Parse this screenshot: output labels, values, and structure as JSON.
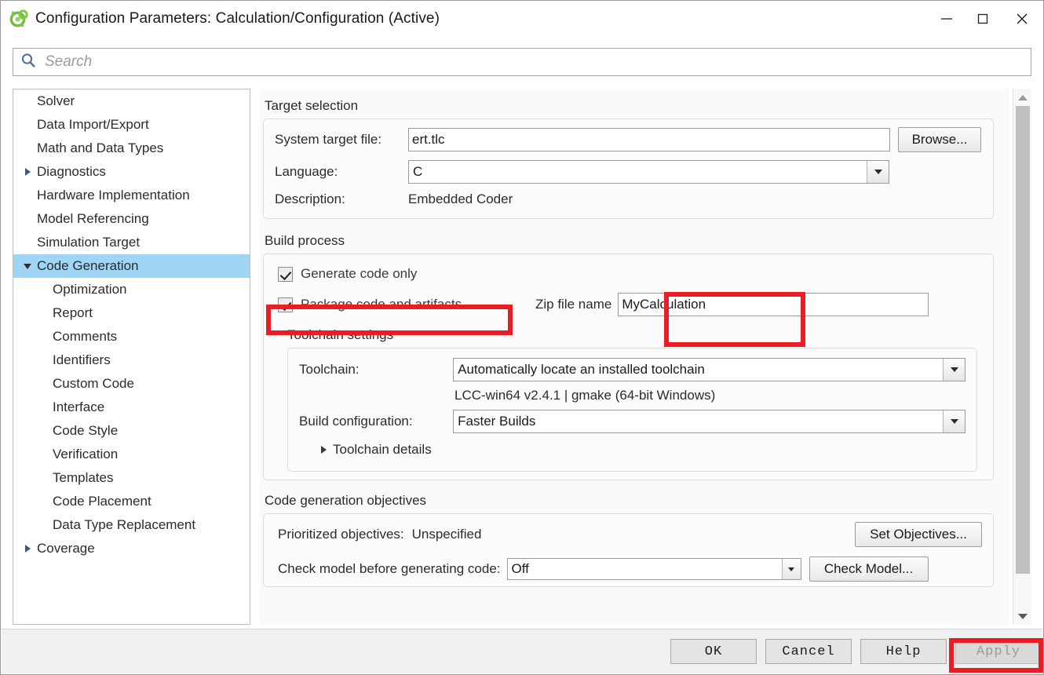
{
  "window": {
    "title": "Configuration Parameters: Calculation/Configuration (Active)",
    "icon": "simulink-icon",
    "minimize_label": "─",
    "maximize_label": "□",
    "close_label": "✕"
  },
  "search": {
    "placeholder": "Search",
    "value": "",
    "icon": "search-icon"
  },
  "sidebar": {
    "items": [
      {
        "label": "Solver",
        "level": 0,
        "twisty": "none",
        "selected": false
      },
      {
        "label": "Data Import/Export",
        "level": 0,
        "twisty": "none",
        "selected": false
      },
      {
        "label": "Math and Data Types",
        "level": 0,
        "twisty": "none",
        "selected": false
      },
      {
        "label": "Diagnostics",
        "level": 0,
        "twisty": "collapsed",
        "selected": false
      },
      {
        "label": "Hardware Implementation",
        "level": 0,
        "twisty": "none",
        "selected": false
      },
      {
        "label": "Model Referencing",
        "level": 0,
        "twisty": "none",
        "selected": false
      },
      {
        "label": "Simulation Target",
        "level": 0,
        "twisty": "none",
        "selected": false
      },
      {
        "label": "Code Generation",
        "level": 0,
        "twisty": "expanded",
        "selected": true
      },
      {
        "label": "Optimization",
        "level": 1,
        "twisty": "none",
        "selected": false
      },
      {
        "label": "Report",
        "level": 1,
        "twisty": "none",
        "selected": false
      },
      {
        "label": "Comments",
        "level": 1,
        "twisty": "none",
        "selected": false
      },
      {
        "label": "Identifiers",
        "level": 1,
        "twisty": "none",
        "selected": false
      },
      {
        "label": "Custom Code",
        "level": 1,
        "twisty": "none",
        "selected": false
      },
      {
        "label": "Interface",
        "level": 1,
        "twisty": "none",
        "selected": false
      },
      {
        "label": "Code Style",
        "level": 1,
        "twisty": "none",
        "selected": false
      },
      {
        "label": "Verification",
        "level": 1,
        "twisty": "none",
        "selected": false
      },
      {
        "label": "Templates",
        "level": 1,
        "twisty": "none",
        "selected": false
      },
      {
        "label": "Code Placement",
        "level": 1,
        "twisty": "none",
        "selected": false
      },
      {
        "label": "Data Type Replacement",
        "level": 1,
        "twisty": "none",
        "selected": false
      },
      {
        "label": "Coverage",
        "level": 0,
        "twisty": "collapsed",
        "selected": false
      }
    ]
  },
  "target_selection": {
    "section_title": "Target selection",
    "system_target_file_label": "System target file:",
    "system_target_file_value": "ert.tlc",
    "browse_label": "Browse...",
    "language_label": "Language:",
    "language_value": "C",
    "description_label": "Description:",
    "description_value": "Embedded Coder"
  },
  "build_process": {
    "section_title": "Build process",
    "generate_code_only_label": "Generate code only",
    "generate_code_only_checked": true,
    "package_code_label": "Package code and artifacts",
    "package_code_checked": true,
    "zip_file_name_label": "Zip file name",
    "zip_file_name_value": "MyCalculation",
    "toolchain_settings_title": "Toolchain settings",
    "toolchain_label": "Toolchain:",
    "toolchain_value": "Automatically locate an installed toolchain",
    "toolchain_info": "LCC-win64 v2.4.1 | gmake (64-bit Windows)",
    "build_configuration_label": "Build configuration:",
    "build_configuration_value": "Faster Builds",
    "toolchain_details_label": "Toolchain details"
  },
  "code_generation_objectives": {
    "section_title": "Code generation objectives",
    "prioritized_objectives_label": "Prioritized objectives:",
    "prioritized_objectives_value": "Unspecified",
    "set_objectives_label": "Set Objectives...",
    "check_model_label": "Check model before generating code:",
    "check_model_value": "Off",
    "check_model_button_label": "Check Model..."
  },
  "footer": {
    "ok_label": "OK",
    "cancel_label": "Cancel",
    "help_label": "Help",
    "apply_label": "Apply",
    "apply_disabled": true
  },
  "annotations": {
    "highlight_color": "#ec1c24",
    "boxes": [
      {
        "name": "package-code-highlight"
      },
      {
        "name": "zip-file-name-highlight"
      },
      {
        "name": "apply-button-highlight"
      }
    ]
  },
  "scrollbar": {
    "up_arrow": "scroll-up-icon",
    "down_arrow": "scroll-down-icon"
  }
}
